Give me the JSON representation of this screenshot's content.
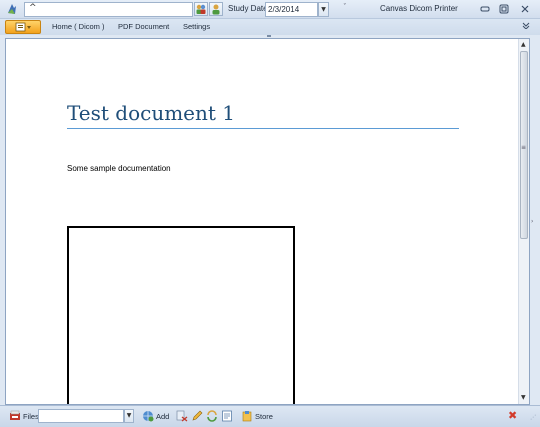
{
  "titlebar": {
    "search_value": "^",
    "study_date_label": "Study Date",
    "study_date_value": "2/3/2014",
    "window_title": "Canvas Dicom Printer",
    "qat_customize": "ˇ"
  },
  "ribbon": {
    "tabs": [
      {
        "label": "Home ( Dicom )"
      },
      {
        "label": "PDF Document"
      },
      {
        "label": "Settings"
      }
    ]
  },
  "document": {
    "title": "Test document 1",
    "body": "Some sample documentation"
  },
  "bottombar": {
    "files_label": "Files",
    "files_value": "",
    "add_label": "Add",
    "store_label": "Store"
  },
  "colors": {
    "heading": "#1f4e79",
    "heading_rule": "#5b9bd5",
    "app_button": "#f2a21d",
    "close": "#d23b2b"
  }
}
